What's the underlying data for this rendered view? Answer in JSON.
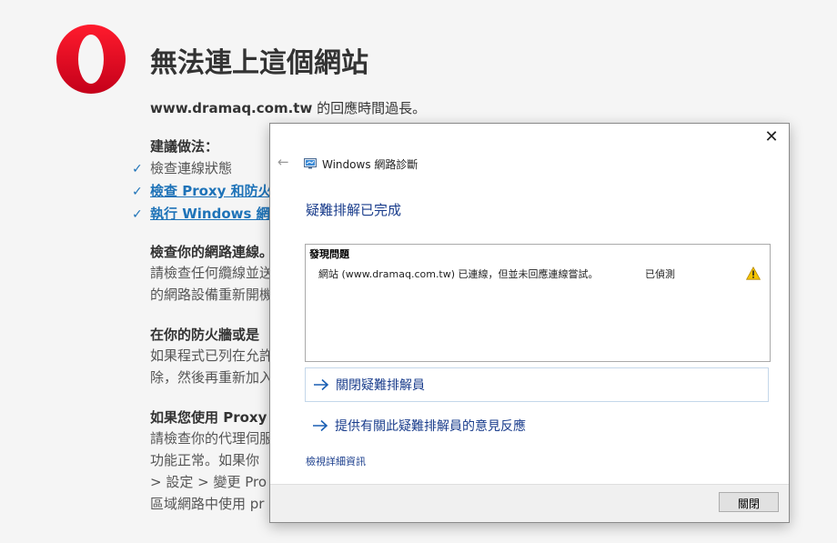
{
  "error_page": {
    "title": "無法連上這個網站",
    "host": "www.dramaq.com.tw",
    "subtitle_suffix": " 的回應時間過長。",
    "suggestions_heading": "建議做法：",
    "suggestions": [
      {
        "label": "檢查連線狀態",
        "link": false
      },
      {
        "label": "檢查 Proxy 和防火",
        "link": true
      },
      {
        "label": "執行 Windows 網",
        "link": true
      }
    ],
    "sections": [
      {
        "heading": "檢查你的網路連線。",
        "lines": [
          "請檢查任何纜線並送",
          "的網路設備重新開機"
        ]
      },
      {
        "heading": "在你的防火牆或是",
        "lines": [
          "如果程式已列在允許",
          "除，然後再重新加入"
        ]
      },
      {
        "heading": "如果您使用 Proxy",
        "lines": [
          "請檢查你的代理伺服",
          "功能正常。如果你",
          "> 設定 > 變更 Pro",
          "區域網路中使用 pr"
        ]
      }
    ],
    "check_glyph": "✓"
  },
  "dialog": {
    "window_title": "Windows 網路診斷",
    "heading": "疑難排解已完成",
    "result_box": {
      "header": "發現問題",
      "issue": "網站 (www.dramaq.com.tw) 已連線，但並未回應連線嘗試。",
      "status": "已偵測",
      "status_icon": "warning-icon"
    },
    "links": [
      {
        "label": "關閉疑難排解員"
      },
      {
        "label": "提供有關此疑難排解員的意見反應"
      }
    ],
    "details_link": "檢視詳細資訊",
    "close_button": "關閉",
    "close_glyph": "✕",
    "back_glyph": "←"
  },
  "colors": {
    "accent_blue": "#1e73b8",
    "dialog_link": "#1a3d8c",
    "opera_red": "#e8101e",
    "warning_yellow": "#f5c400"
  }
}
